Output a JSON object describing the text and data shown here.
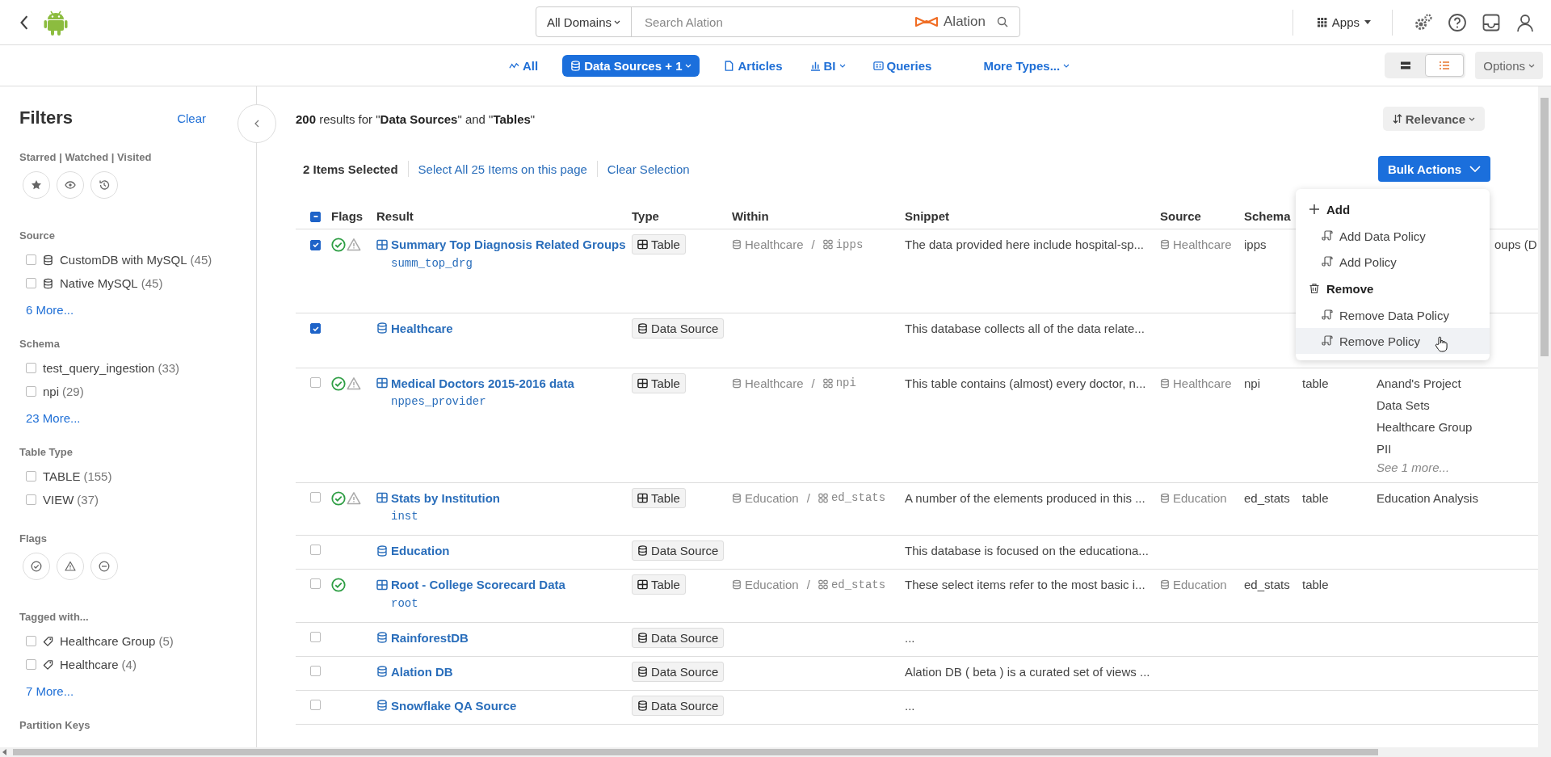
{
  "topbar": {
    "domain": "All Domains",
    "search_placeholder": "Search Alation",
    "logo_text": "Alation",
    "apps": "Apps"
  },
  "type_tabs": [
    {
      "label": "All",
      "selected": false,
      "dropdown": false
    },
    {
      "label": "Data Sources + 1",
      "selected": true,
      "dropdown": true
    },
    {
      "label": "Articles",
      "selected": false,
      "dropdown": false
    },
    {
      "label": "BI",
      "selected": false,
      "dropdown": true
    },
    {
      "label": "Queries",
      "selected": false,
      "dropdown": false
    },
    {
      "label": "More Types...",
      "selected": false,
      "dropdown": true
    }
  ],
  "view_modes": [
    {
      "kind": "cards",
      "selected": false
    },
    {
      "kind": "list",
      "selected": true
    }
  ],
  "options": "Options",
  "filters": {
    "title": "Filters",
    "clear": "Clear",
    "sections": [
      {
        "title": "Starred | Watched | Visited",
        "kind": "activity"
      },
      {
        "title": "Source",
        "kind": "checks",
        "items": [
          {
            "label": "CustomDB with MySQL",
            "count": "(45)",
            "kind": "database",
            "checked": false
          },
          {
            "label": "Native MySQL",
            "count": "(45)",
            "kind": "database",
            "checked": false
          }
        ],
        "more": "6 More..."
      },
      {
        "title": "Schema",
        "kind": "checks",
        "items": [
          {
            "label": "test_query_ingestion",
            "count": "(33)",
            "kind": "plain",
            "checked": false
          },
          {
            "label": "npi",
            "count": "(29)",
            "kind": "plain",
            "checked": false
          }
        ],
        "more": "23 More..."
      },
      {
        "title": "Table Type",
        "kind": "checks",
        "items": [
          {
            "label": "TABLE",
            "count": "(155)",
            "kind": "plain",
            "checked": false
          },
          {
            "label": "VIEW",
            "count": "(37)",
            "kind": "plain",
            "checked": false
          }
        ]
      },
      {
        "title": "Flags",
        "kind": "flags"
      },
      {
        "title": "Tagged with...",
        "kind": "checks",
        "items": [
          {
            "label": "Healthcare Group",
            "count": "(5)",
            "kind": "tag",
            "checked": false
          },
          {
            "label": "Healthcare",
            "count": "(4)",
            "kind": "tag",
            "checked": false
          }
        ],
        "more": "7 More..."
      },
      {
        "title": "Partition Keys",
        "kind": "checks"
      }
    ]
  },
  "results_text": "**200** results for \"**Data Sources**\" and \"**Tables**\"",
  "sort": "Relevance",
  "selection": {
    "count_label": "2 Items Selected",
    "select_all": "Select All 25 Items on this page",
    "clear": "Clear Selection"
  },
  "bulk_actions": "Bulk Actions",
  "menu": [
    {
      "label": "Add",
      "kind": "add",
      "items": [
        {
          "label": "Add Data Policy",
          "hovered": false
        },
        {
          "label": "Add Policy",
          "hovered": false
        }
      ]
    },
    {
      "label": "Remove",
      "kind": "remove",
      "items": [
        {
          "label": "Remove Data Policy",
          "hovered": false
        },
        {
          "label": "Remove Policy",
          "hovered": true
        }
      ]
    }
  ],
  "select_all_partial": true,
  "columns": [
    "Flags",
    "Result",
    "Type",
    "Within",
    "Snippet",
    "Source",
    "Schema"
  ],
  "rows": [
    {
      "checked": true,
      "endorsed": true,
      "warning": true,
      "kind": "table",
      "title": "Summary Top Diagnosis Related Groups",
      "subtitle": "summ_top_drg",
      "type_label": "Table",
      "within_source": "Healthcare",
      "within_sep": "/",
      "within_schema": "ipps",
      "snippet": "The data provided here include hospital-sp...",
      "source": "Healthcare",
      "schema": "ipps",
      "tags": [
        "oups (D"
      ],
      "tags_covered": true
    },
    {
      "checked": true,
      "endorsed": false,
      "warning": false,
      "kind": "datasource",
      "title": "Healthcare",
      "type_label": "Data Source",
      "snippet": "This database collects all of the data relate..."
    },
    {
      "checked": false,
      "endorsed": true,
      "warning": true,
      "kind": "table",
      "title": "Medical Doctors 2015-2016 data",
      "subtitle": "nppes_provider",
      "type_label": "Table",
      "within_source": "Healthcare",
      "within_sep": "/",
      "within_schema": "npi",
      "snippet": "This table contains (almost) every doctor, n...",
      "source": "Healthcare",
      "schema": "npi",
      "object_type": "table",
      "tags": [
        "Anand's Project",
        "Data Sets",
        "Healthcare Group",
        "PII"
      ],
      "tags_covered": false,
      "more": "See 1 more..."
    },
    {
      "checked": false,
      "endorsed": true,
      "warning": true,
      "kind": "table",
      "title": "Stats by Institution",
      "subtitle": "inst",
      "type_label": "Table",
      "within_source": "Education",
      "within_sep": "/",
      "within_schema": "ed_stats",
      "snippet": "A number of the elements produced in this ...",
      "source": "Education",
      "schema": "ed_stats",
      "object_type": "table",
      "tags": [
        "Education Analysis"
      ],
      "tags_covered": false
    },
    {
      "checked": false,
      "endorsed": false,
      "warning": false,
      "kind": "datasource",
      "title": "Education",
      "type_label": "Data Source",
      "snippet": "This database is focused on the educationa..."
    },
    {
      "checked": false,
      "endorsed": true,
      "warning": false,
      "kind": "table",
      "title": "Root - College Scorecard Data",
      "subtitle": "root",
      "type_label": "Table",
      "within_source": "Education",
      "within_sep": "/",
      "within_schema": "ed_stats",
      "snippet": "These select items refer to the most basic i...",
      "source": "Education",
      "schema": "ed_stats",
      "object_type": "table"
    },
    {
      "checked": false,
      "endorsed": false,
      "warning": false,
      "kind": "datasource",
      "title": "RainforestDB",
      "type_label": "Data Source",
      "snippet": "..."
    },
    {
      "checked": false,
      "endorsed": false,
      "warning": false,
      "kind": "datasource",
      "title": "Alation DB",
      "type_label": "Data Source",
      "snippet": "Alation DB ( beta ) is a curated set of views ..."
    },
    {
      "checked": false,
      "endorsed": false,
      "warning": false,
      "kind": "datasource",
      "title": "Snowflake QA Source",
      "type_label": "Data Source",
      "snippet": "..."
    }
  ]
}
